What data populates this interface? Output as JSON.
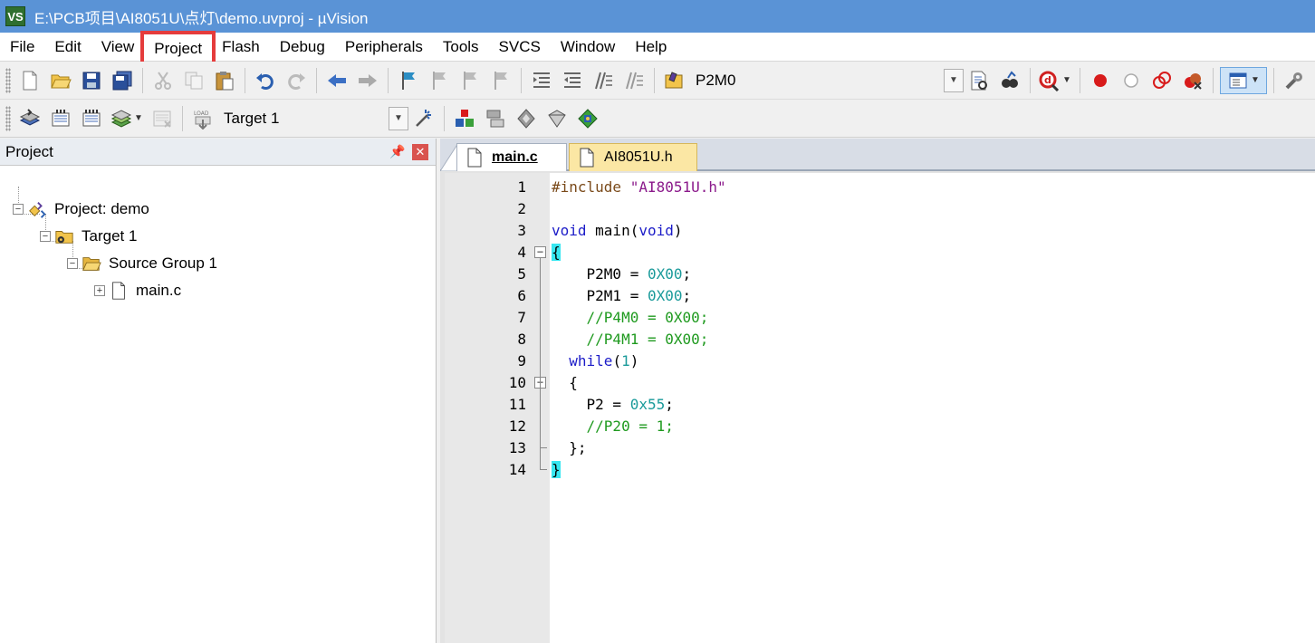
{
  "window": {
    "title": "E:\\PCB项目\\AI8051U\\点灯\\demo.uvproj - µVision",
    "app_icon": "VS"
  },
  "menubar": {
    "items": [
      {
        "label": "File",
        "highlighted": false
      },
      {
        "label": "Edit",
        "highlighted": false
      },
      {
        "label": "View",
        "highlighted": false
      },
      {
        "label": "Project",
        "highlighted": true
      },
      {
        "label": "Flash",
        "highlighted": false
      },
      {
        "label": "Debug",
        "highlighted": false
      },
      {
        "label": "Peripherals",
        "highlighted": false
      },
      {
        "label": "Tools",
        "highlighted": false
      },
      {
        "label": "SVCS",
        "highlighted": false
      },
      {
        "label": "Window",
        "highlighted": false
      },
      {
        "label": "Help",
        "highlighted": false
      }
    ],
    "highlight_color": "#e53c3c"
  },
  "toolbar1": {
    "find_combo_value": "P2M0"
  },
  "toolbar2": {
    "target_combo_value": "Target 1"
  },
  "project_panel": {
    "title": "Project",
    "tree": [
      {
        "label": "Project: demo",
        "icon": "project-icon",
        "expanded": true
      },
      {
        "label": "Target 1",
        "icon": "target-icon",
        "expanded": true
      },
      {
        "label": "Source Group 1",
        "icon": "folder-icon",
        "expanded": true
      },
      {
        "label": "main.c",
        "icon": "file-icon",
        "expanded": false
      }
    ]
  },
  "editor": {
    "tabs": [
      {
        "label": "main.c",
        "active": true
      },
      {
        "label": "AI8051U.h",
        "active": false
      }
    ],
    "lines": [
      {
        "n": "1",
        "tokens": [
          {
            "t": "#include ",
            "c": "pp"
          },
          {
            "t": "\"AI8051U.h\"",
            "c": "str"
          }
        ]
      },
      {
        "n": "2",
        "tokens": []
      },
      {
        "n": "3",
        "tokens": [
          {
            "t": "void",
            "c": "kw"
          },
          {
            "t": " main(",
            "c": ""
          },
          {
            "t": "void",
            "c": "kw"
          },
          {
            "t": ")",
            "c": ""
          }
        ]
      },
      {
        "n": "4",
        "tokens": [
          {
            "t": "{",
            "c": "brace"
          }
        ],
        "fold": "open"
      },
      {
        "n": "5",
        "tokens": [
          {
            "t": "    P2M0 = ",
            "c": ""
          },
          {
            "t": "0X00",
            "c": "num"
          },
          {
            "t": ";",
            "c": ""
          }
        ]
      },
      {
        "n": "6",
        "tokens": [
          {
            "t": "    P2M1 = ",
            "c": ""
          },
          {
            "t": "0X00",
            "c": "num"
          },
          {
            "t": ";",
            "c": ""
          }
        ]
      },
      {
        "n": "7",
        "tokens": [
          {
            "t": "    //P4M0 = 0X00;",
            "c": "cmt"
          }
        ]
      },
      {
        "n": "8",
        "tokens": [
          {
            "t": "    //P4M1 = 0X00;",
            "c": "cmt"
          }
        ]
      },
      {
        "n": "9",
        "tokens": [
          {
            "t": "  ",
            "c": ""
          },
          {
            "t": "while",
            "c": "kw"
          },
          {
            "t": "(",
            "c": ""
          },
          {
            "t": "1",
            "c": "num"
          },
          {
            "t": ")",
            "c": ""
          }
        ]
      },
      {
        "n": "10",
        "tokens": [
          {
            "t": "  {",
            "c": ""
          }
        ],
        "fold": "open"
      },
      {
        "n": "11",
        "tokens": [
          {
            "t": "    P2 = ",
            "c": ""
          },
          {
            "t": "0x55",
            "c": "num"
          },
          {
            "t": ";",
            "c": ""
          }
        ]
      },
      {
        "n": "12",
        "tokens": [
          {
            "t": "    //P20 = 1;",
            "c": "cmt"
          }
        ]
      },
      {
        "n": "13",
        "tokens": [
          {
            "t": "  };",
            "c": ""
          }
        ],
        "fold": "end"
      },
      {
        "n": "14",
        "tokens": [
          {
            "t": "}",
            "c": "brace"
          }
        ],
        "fold": "end"
      }
    ]
  },
  "colors": {
    "titlebar": "#5a93d6",
    "keyword": "#1c1cc8",
    "number": "#1a9a9a",
    "comment": "#1f9a1f",
    "brace_highlight": "#38e6f0"
  }
}
